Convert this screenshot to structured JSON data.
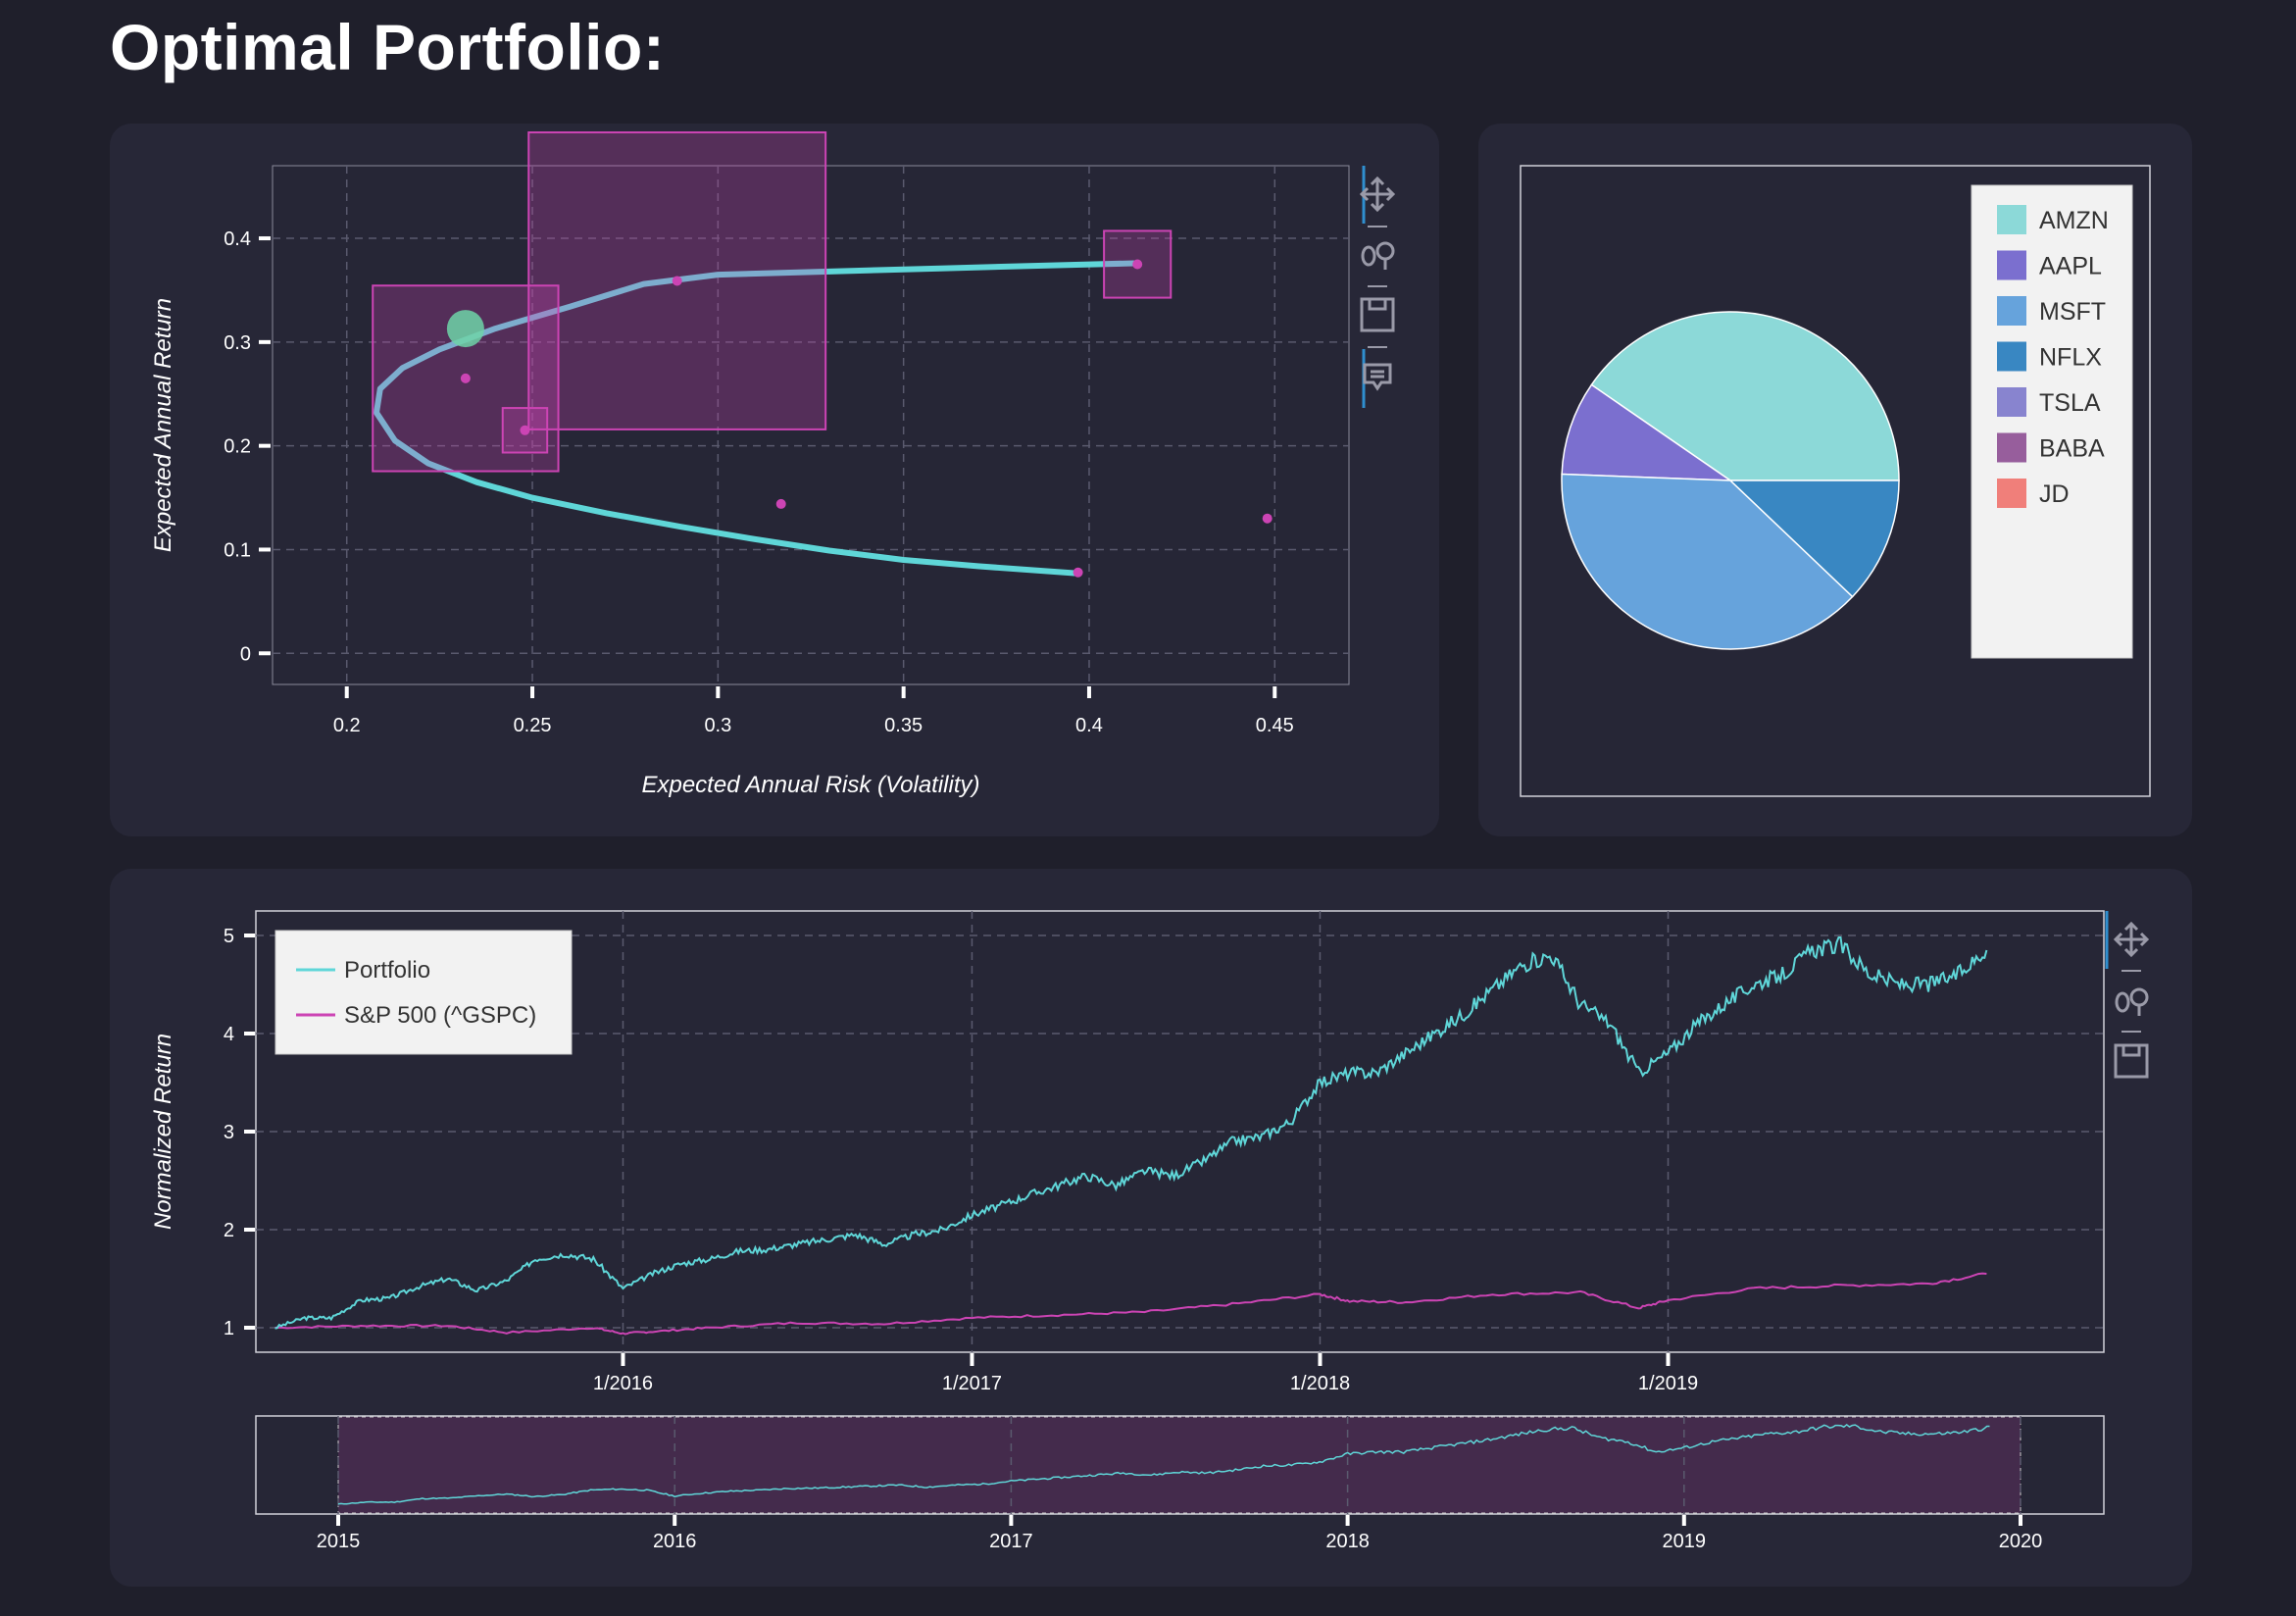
{
  "page": {
    "title": "Optimal Portfolio:"
  },
  "colors": {
    "background": "#1f1f2b",
    "card": "#272737",
    "plot_bg": "#262636",
    "frontier": "#5fd6d8",
    "markers": "#cc44b4",
    "optimal": "#6fd3a8",
    "portfolio": "#5fd6d8",
    "benchmark": "#cc44b4",
    "accent": "#2f8fcf"
  },
  "toolbar_icons": {
    "pan": "pan-icon",
    "wheel_zoom": "wheel-zoom-icon",
    "save": "save-icon",
    "hover": "hover-icon"
  },
  "chart_data": [
    {
      "type": "line",
      "name": "efficient-frontier",
      "xlabel": "Expected Annual Risk (Volatility)",
      "ylabel": "Expected Annual Return",
      "xlim": [
        0.18,
        0.47
      ],
      "ylim": [
        -0.03,
        0.47
      ],
      "xticks": [
        "0.2",
        "0.25",
        "0.3",
        "0.35",
        "0.4",
        "0.45"
      ],
      "yticks": [
        "0",
        "0.1",
        "0.2",
        "0.3",
        "0.4"
      ],
      "grid": true,
      "series": [
        {
          "x": [
            0.397,
            0.37,
            0.35,
            0.33,
            0.31,
            0.29,
            0.27,
            0.25,
            0.235,
            0.222,
            0.213,
            0.208,
            0.209,
            0.215,
            0.225,
            0.24,
            0.26,
            0.28,
            0.3,
            0.33,
            0.36,
            0.39,
            0.412
          ],
          "y": [
            0.077,
            0.084,
            0.09,
            0.099,
            0.11,
            0.122,
            0.135,
            0.15,
            0.165,
            0.183,
            0.205,
            0.232,
            0.255,
            0.275,
            0.293,
            0.313,
            0.334,
            0.356,
            0.365,
            0.368,
            0.371,
            0.374,
            0.376
          ]
        }
      ],
      "assets": [
        {
          "x": 0.232,
          "y": 0.265,
          "size": 0.05
        },
        {
          "x": 0.248,
          "y": 0.215,
          "size": 0.012
        },
        {
          "x": 0.289,
          "y": 0.359,
          "size": 0.08
        },
        {
          "x": 0.317,
          "y": 0.144,
          "size": 0
        },
        {
          "x": 0.397,
          "y": 0.078,
          "size": 0
        },
        {
          "x": 0.413,
          "y": 0.375,
          "size": 0.018
        },
        {
          "x": 0.448,
          "y": 0.13,
          "size": 0
        }
      ],
      "optimal_point": {
        "x": 0.232,
        "y": 0.313
      }
    },
    {
      "type": "pie",
      "name": "allocation",
      "legend_position": "top-right",
      "slices": [
        {
          "label": "AMZN",
          "value": 0.404,
          "color": "#8cd9d8"
        },
        {
          "label": "AAPL",
          "value": 0.09,
          "color": "#7b6fcf"
        },
        {
          "label": "MSFT",
          "value": 0.385,
          "color": "#66a3dc"
        },
        {
          "label": "NFLX",
          "value": 0.121,
          "color": "#3987c2"
        },
        {
          "label": "TSLA",
          "value": 0,
          "color": "#8884cf"
        },
        {
          "label": "BABA",
          "value": 0,
          "color": "#975e9c"
        },
        {
          "label": "JD",
          "value": 0,
          "color": "#f07f7a"
        }
      ]
    },
    {
      "type": "line",
      "name": "normalized-returns",
      "ylabel": "Normalized Return",
      "ylim": [
        0.75,
        5.25
      ],
      "yticks": [
        "1",
        "2",
        "3",
        "4",
        "5"
      ],
      "xticks": [
        "1/2016",
        "1/2017",
        "1/2018",
        "1/2019"
      ],
      "xrange": [
        "2015-01-01",
        "2020-01-01"
      ],
      "grid": true,
      "legend_position": "top-left",
      "series": [
        {
          "name": "Portfolio",
          "x": [
            "2015-01",
            "2015-02",
            "2015-03",
            "2015-04",
            "2015-05",
            "2015-06",
            "2015-07",
            "2015-08",
            "2015-09",
            "2015-10",
            "2015-11",
            "2015-12",
            "2016-01",
            "2016-02",
            "2016-03",
            "2016-04",
            "2016-05",
            "2016-06",
            "2016-07",
            "2016-08",
            "2016-09",
            "2016-10",
            "2016-11",
            "2016-12",
            "2017-01",
            "2017-02",
            "2017-03",
            "2017-04",
            "2017-05",
            "2017-06",
            "2017-07",
            "2017-08",
            "2017-09",
            "2017-10",
            "2017-11",
            "2017-12",
            "2018-01",
            "2018-02",
            "2018-03",
            "2018-04",
            "2018-05",
            "2018-06",
            "2018-07",
            "2018-08",
            "2018-09",
            "2018-10",
            "2018-11",
            "2018-12",
            "2019-01",
            "2019-02",
            "2019-03",
            "2019-04",
            "2019-05",
            "2019-06",
            "2019-07",
            "2019-08",
            "2019-09",
            "2019-10",
            "2019-11",
            "2019-12"
          ],
          "values": [
            1.0,
            1.1,
            1.1,
            1.28,
            1.3,
            1.42,
            1.5,
            1.38,
            1.48,
            1.7,
            1.75,
            1.7,
            1.4,
            1.55,
            1.65,
            1.7,
            1.78,
            1.8,
            1.85,
            1.9,
            1.95,
            1.85,
            1.95,
            2.0,
            2.15,
            2.25,
            2.35,
            2.45,
            2.55,
            2.45,
            2.6,
            2.55,
            2.7,
            2.9,
            2.95,
            3.1,
            3.5,
            3.6,
            3.6,
            3.8,
            4.0,
            4.2,
            4.45,
            4.7,
            4.8,
            4.3,
            4.1,
            3.6,
            3.8,
            4.1,
            4.3,
            4.5,
            4.6,
            4.85,
            4.9,
            4.6,
            4.5,
            4.5,
            4.6,
            4.85
          ]
        },
        {
          "name": "S&P 500 (^GSPC)",
          "x": [
            "2015-01",
            "2015-04",
            "2015-07",
            "2015-09",
            "2015-12",
            "2016-01",
            "2016-02",
            "2016-04",
            "2016-07",
            "2016-10",
            "2017-01",
            "2017-04",
            "2017-07",
            "2017-10",
            "2018-01",
            "2018-02",
            "2018-04",
            "2018-07",
            "2018-10",
            "2018-12",
            "2019-01",
            "2019-04",
            "2019-07",
            "2019-10",
            "2019-12"
          ],
          "values": [
            1.0,
            1.02,
            1.02,
            0.95,
            1.0,
            0.94,
            0.96,
            1.0,
            1.05,
            1.04,
            1.1,
            1.13,
            1.16,
            1.24,
            1.34,
            1.27,
            1.26,
            1.34,
            1.36,
            1.2,
            1.28,
            1.4,
            1.43,
            1.45,
            1.55
          ]
        }
      ]
    },
    {
      "type": "area",
      "name": "range-selector",
      "xticks": [
        "2015",
        "2016",
        "2017",
        "2018",
        "2019",
        "2020"
      ],
      "selected_range": [
        "2015",
        "2020"
      ]
    }
  ]
}
